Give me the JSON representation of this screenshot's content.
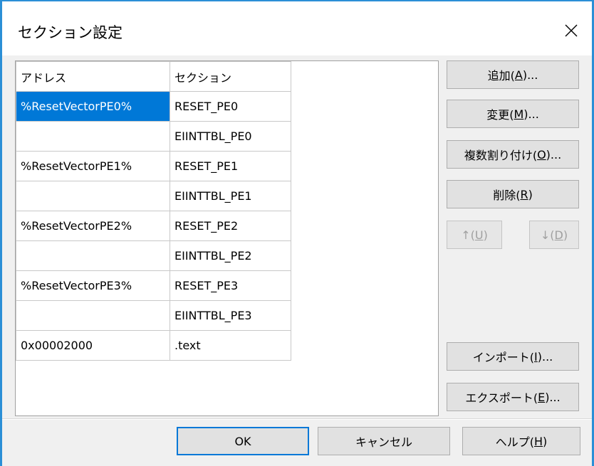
{
  "dialog": {
    "title": "セクション設定",
    "close_glyph": "✕"
  },
  "grid": {
    "columns": [
      "アドレス",
      "セクション"
    ],
    "rows": [
      {
        "address": "%ResetVectorPE0%",
        "section": "RESET_PE0",
        "selected": true
      },
      {
        "address": "",
        "section": "EIINTTBL_PE0"
      },
      {
        "address": "%ResetVectorPE1%",
        "section": "RESET_PE1"
      },
      {
        "address": "",
        "section": "EIINTTBL_PE1"
      },
      {
        "address": "%ResetVectorPE2%",
        "section": "RESET_PE2"
      },
      {
        "address": "",
        "section": "EIINTTBL_PE2"
      },
      {
        "address": "%ResetVectorPE3%",
        "section": "RESET_PE3"
      },
      {
        "address": "",
        "section": "EIINTTBL_PE3"
      },
      {
        "address": "0x00002000",
        "section": ".text"
      }
    ]
  },
  "buttons": {
    "add": {
      "pre": "追加(",
      "key": "A",
      "post": ")..."
    },
    "change": {
      "pre": "変更(",
      "key": "M",
      "post": ")..."
    },
    "multi_assign": {
      "pre": "複数割り付け(",
      "key": "O",
      "post": ")..."
    },
    "delete": {
      "pre": "削除(",
      "key": "R",
      "post": ")"
    },
    "up": {
      "pre": "↑(",
      "key": "U",
      "post": ")"
    },
    "down": {
      "pre": "↓(",
      "key": "D",
      "post": ")"
    },
    "import": {
      "pre": "インポート(",
      "key": "I",
      "post": ")..."
    },
    "export": {
      "pre": "エクスポート(",
      "key": "E",
      "post": ")..."
    },
    "ok": {
      "label": "OK"
    },
    "cancel": {
      "label": "キャンセル"
    },
    "help": {
      "pre": "ヘルプ(",
      "key": "H",
      "post": ")"
    }
  },
  "colors": {
    "selection": "#0078d7",
    "frame": "#2b8fd6",
    "button_face": "#e1e1e1"
  }
}
